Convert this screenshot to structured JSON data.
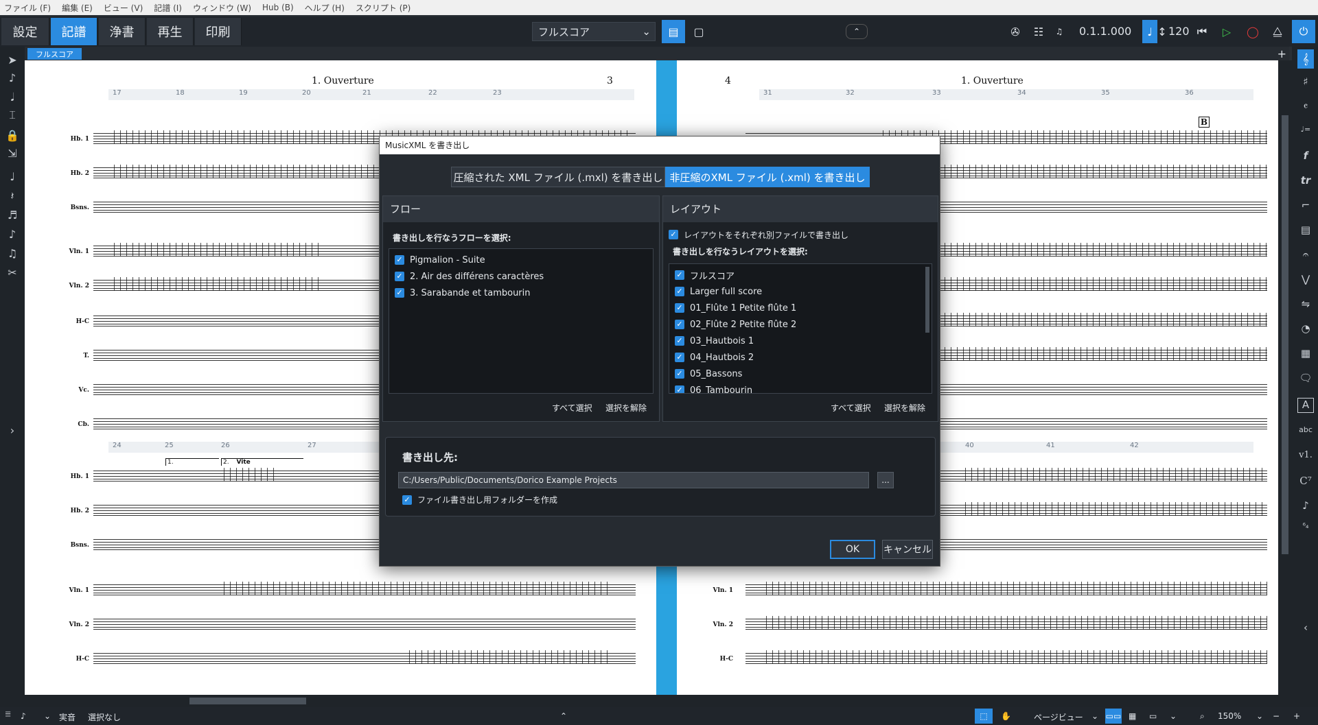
{
  "menu": [
    "ファイル (F)",
    "編集 (E)",
    "ビュー (V)",
    "記譜 (I)",
    "ウィンドウ (W)",
    "Hub (B)",
    "ヘルプ (H)",
    "スクリプト (P)"
  ],
  "toolbar": {
    "modes": [
      "設定",
      "記譜",
      "浄書",
      "再生",
      "印刷"
    ],
    "active_mode": "記譜",
    "layout_select": "フルスコア",
    "timecode": "0.1.1.000",
    "tempo": "120"
  },
  "tab": {
    "label": "フルスコア"
  },
  "score": {
    "left_page": {
      "title": "1. Ouverture",
      "page_number": "3",
      "bars_top": [
        "17",
        "18",
        "19",
        "20",
        "21",
        "22",
        "23"
      ],
      "bars_bottom": [
        "24",
        "25",
        "26",
        "27"
      ],
      "volta1": "1.",
      "volta2": "2.",
      "tempo_marking": "Vite"
    },
    "right_page": {
      "title": "1. Ouverture",
      "page_number": "4",
      "bars_top": [
        "31",
        "32",
        "33",
        "34",
        "35",
        "36"
      ],
      "bars_bottom": [
        "40",
        "41",
        "42"
      ],
      "rehearsal_mark": "B"
    },
    "staves_top": [
      "Hb. 1",
      "Hb. 2",
      "Bsns.",
      "Vln. 1",
      "Vln. 2",
      "H-C",
      "T.",
      "Vc.",
      "Cb."
    ],
    "staves_bottom": [
      "Hb. 1",
      "Hb. 2",
      "Bsns.",
      "Vln. 1",
      "Vln. 2",
      "H-C"
    ]
  },
  "dialog": {
    "title": "MusicXML を書き出し",
    "export_compressed": "圧縮された XML ファイル (.mxl) を書き出し",
    "export_uncompressed": "非圧縮のXML ファイル (.xml) を書き出し",
    "flows": {
      "header": "フロー",
      "label": "書き出しを行なうフローを選択:",
      "items": [
        "Pigmalion - Suite",
        "2. Air des différens caractères",
        "3. Sarabande et tambourin"
      ],
      "select_all": "すべて選択",
      "deselect": "選択を解除"
    },
    "layouts": {
      "header": "レイアウト",
      "separate_files": "レイアウトをそれぞれ別ファイルで書き出し",
      "label": "書き出しを行なうレイアウトを選択:",
      "items": [
        "フルスコア",
        "Larger full score",
        "01_Flûte 1  Petite flûte 1",
        "02_Flûte 2  Petite flûte 2",
        "03_Hautbois 1",
        "04_Hautbois 2",
        "05_Bassons",
        "06_Tambourin"
      ],
      "select_all": "すべて選択",
      "deselect": "選択を解除"
    },
    "destination": {
      "label": "書き出し先:",
      "path": "C:/Users/Public/Documents/Dorico Example Projects",
      "browse": "...",
      "create_folder": "ファイル書き出し用フォルダーを作成"
    },
    "ok": "OK",
    "cancel": "キャンセル"
  },
  "status": {
    "sound": "実音",
    "selection": "選択なし",
    "view_mode": "ページビュー",
    "zoom": "150%"
  }
}
